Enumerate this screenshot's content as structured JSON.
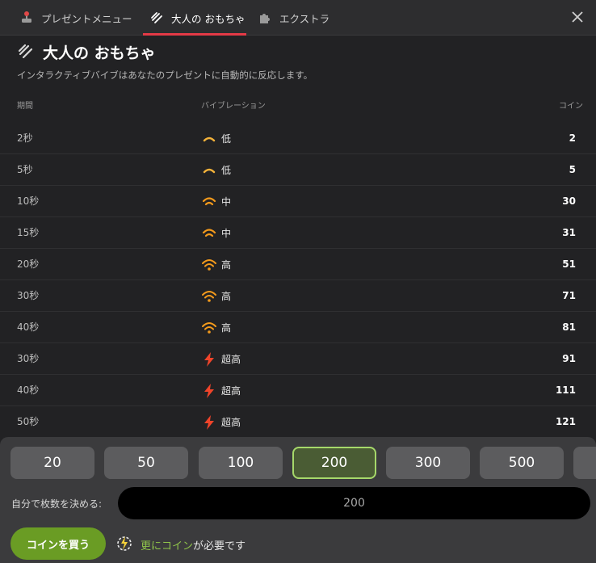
{
  "tabs": [
    {
      "label": "プレゼントメニュー",
      "icon": "joystick-icon"
    },
    {
      "label": "大人の おもちゃ",
      "icon": "toy-icon"
    },
    {
      "label": "エクストラ",
      "icon": "puzzle-icon"
    }
  ],
  "header": {
    "title": "大人の おもちゃ",
    "subtitle": "インタラクティブバイブはあなたのプレゼントに自動的に反応します。"
  },
  "table": {
    "headers": {
      "duration": "期間",
      "vibration": "バイブレーション",
      "coins": "コイン"
    },
    "rows": [
      {
        "duration": "2秒",
        "level": "低",
        "level_icon": "low-wave-icon",
        "coins": "2"
      },
      {
        "duration": "5秒",
        "level": "低",
        "level_icon": "low-wave-icon",
        "coins": "5"
      },
      {
        "duration": "10秒",
        "level": "中",
        "level_icon": "medium-wave-icon",
        "coins": "30"
      },
      {
        "duration": "15秒",
        "level": "中",
        "level_icon": "medium-wave-icon",
        "coins": "31"
      },
      {
        "duration": "20秒",
        "level": "高",
        "level_icon": "high-wave-icon",
        "coins": "51"
      },
      {
        "duration": "30秒",
        "level": "高",
        "level_icon": "high-wave-icon",
        "coins": "71"
      },
      {
        "duration": "40秒",
        "level": "高",
        "level_icon": "high-wave-icon",
        "coins": "81"
      },
      {
        "duration": "30秒",
        "level": "超高",
        "level_icon": "lightning-icon",
        "coins": "91"
      },
      {
        "duration": "40秒",
        "level": "超高",
        "level_icon": "lightning-icon",
        "coins": "111"
      },
      {
        "duration": "50秒",
        "level": "超高",
        "level_icon": "lightning-icon",
        "coins": "121"
      }
    ]
  },
  "amounts": [
    "20",
    "50",
    "100",
    "200",
    "300",
    "500",
    ""
  ],
  "selected_amount": "200",
  "custom": {
    "label": "自分で枚数を決める:",
    "value": "200"
  },
  "buy_button": "コインを買う",
  "more_coins": {
    "link": "更にコイン",
    "text": "が必要です",
    "icon": "coin-bolt-icon"
  },
  "colors": {
    "accent": "#e53a46",
    "wave": "#f39a1c",
    "lightning": "#f0442a",
    "buy": "#6a9c24",
    "selected_border": "#a6d86a"
  }
}
